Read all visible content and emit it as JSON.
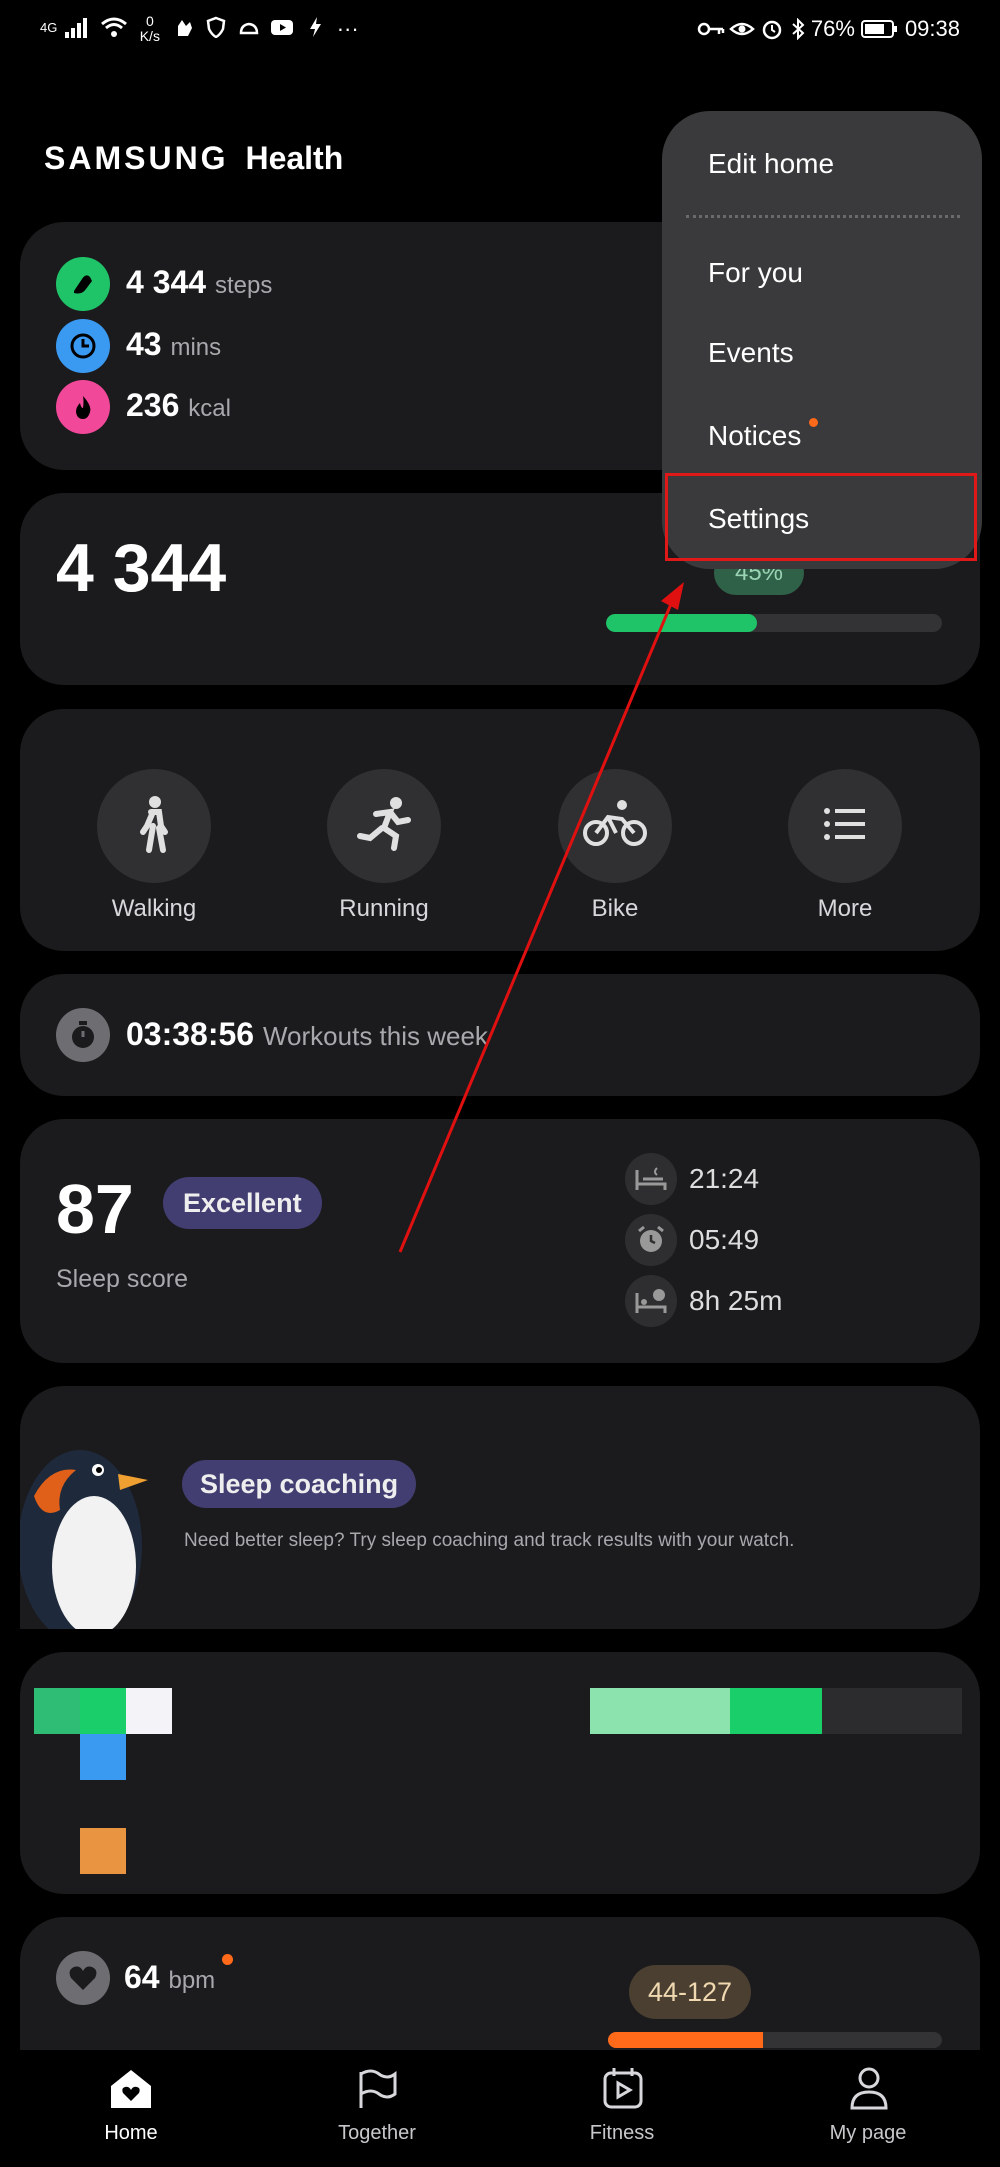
{
  "status_bar": {
    "network": "4G",
    "speed_value": "0",
    "speed_unit": "K/s",
    "more": "···",
    "battery": "76%",
    "time": "09:38"
  },
  "header": {
    "brand": "SAMSUNG",
    "app": "Health"
  },
  "summary": {
    "steps_value": "4 344",
    "steps_unit": "steps",
    "mins_value": "43",
    "mins_unit": "mins",
    "kcal_value": "236",
    "kcal_unit": "kcal",
    "steps_color": "#1fc468",
    "mins_color": "#3a9af2",
    "kcal_color": "#f2489a"
  },
  "steps_card": {
    "value": "4 344",
    "percent_label": "45%",
    "progress": 0.45
  },
  "activities": [
    {
      "label": "Walking",
      "icon": "walking-icon"
    },
    {
      "label": "Running",
      "icon": "running-icon"
    },
    {
      "label": "Bike",
      "icon": "bike-icon"
    },
    {
      "label": "More",
      "icon": "list-icon"
    }
  ],
  "workouts": {
    "time": "03:38:56",
    "label": "Workouts this week"
  },
  "sleep": {
    "score": "87",
    "rating": "Excellent",
    "label": "Sleep score",
    "bedtime": "21:24",
    "wake": "05:49",
    "duration": "8h 25m"
  },
  "coaching": {
    "title": "Sleep coaching",
    "text": "Need better sleep? Try sleep coaching and track results with your watch."
  },
  "heart": {
    "value": "64",
    "unit": "bpm",
    "range": "44-127",
    "accent": "#ff6a1a"
  },
  "menu": {
    "edit_home": "Edit home",
    "for_you": "For you",
    "events": "Events",
    "notices": "Notices",
    "settings": "Settings"
  },
  "nav": {
    "home": "Home",
    "together": "Together",
    "fitness": "Fitness",
    "mypage": "My page"
  }
}
